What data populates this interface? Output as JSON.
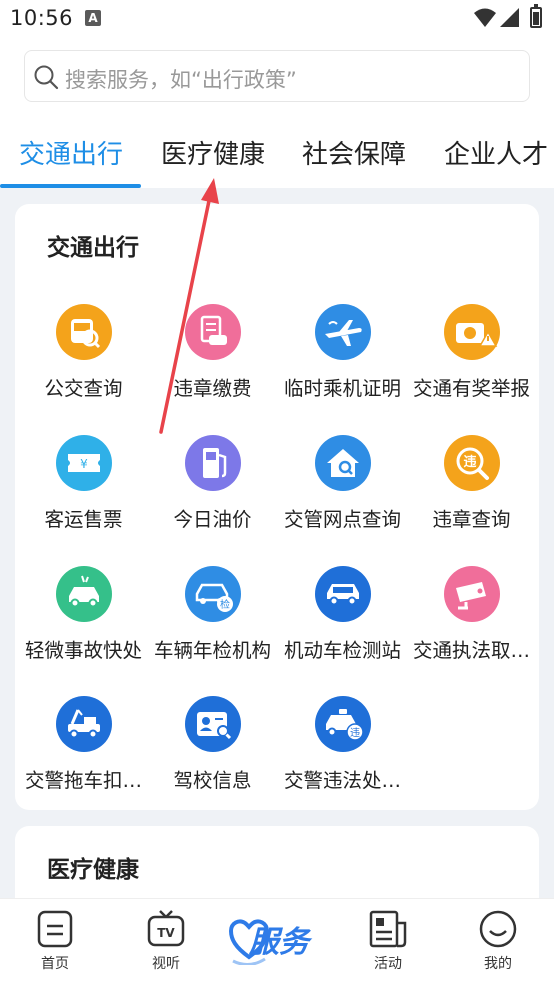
{
  "status_bar": {
    "time": "10:56",
    "notification_letter": "A"
  },
  "search": {
    "placeholder": "搜索服务，如“出行政策”"
  },
  "tabs": [
    {
      "label": "交通出行",
      "active": true
    },
    {
      "label": "医疗健康",
      "active": false
    },
    {
      "label": "社会保障",
      "active": false
    },
    {
      "label": "企业人才",
      "active": false
    }
  ],
  "sections": [
    {
      "title": "交通出行",
      "items": [
        {
          "label": "公交查询",
          "icon": "bus-search-icon",
          "color": "#f4a31b"
        },
        {
          "label": "违章缴费",
          "icon": "ticket-car-icon",
          "color": "#f06e9a"
        },
        {
          "label": "临时乘机证明",
          "icon": "airplane-icon",
          "color": "#2f8de4"
        },
        {
          "label": "交通有奖举报",
          "icon": "camera-warning-icon",
          "color": "#f4a31b"
        },
        {
          "label": "客运售票",
          "icon": "ticket-yen-icon",
          "color": "#2fb0e8"
        },
        {
          "label": "今日油价",
          "icon": "fuel-pump-icon",
          "color": "#7d78e8"
        },
        {
          "label": "交管网点查询",
          "icon": "house-search-icon",
          "color": "#2f8de4"
        },
        {
          "label": "违章查询",
          "icon": "violation-search-icon",
          "color": "#f4a31b"
        },
        {
          "label": "轻微事故快处",
          "icon": "car-accident-icon",
          "color": "#35c08a"
        },
        {
          "label": "车辆年检机构",
          "icon": "car-inspection-icon",
          "color": "#2f8de4"
        },
        {
          "label": "机动车检测站",
          "icon": "car-wrench-icon",
          "color": "#1f6fd8"
        },
        {
          "label": "交通执法取…",
          "icon": "surveillance-camera-icon",
          "color": "#f06e9a"
        },
        {
          "label": "交警拖车扣…",
          "icon": "tow-truck-icon",
          "color": "#1f6fd8"
        },
        {
          "label": "驾校信息",
          "icon": "id-card-icon",
          "color": "#1f6fd8"
        },
        {
          "label": "交警违法处…",
          "icon": "police-car-icon",
          "color": "#1f6fd8"
        }
      ]
    },
    {
      "title": "医疗健康"
    }
  ],
  "bottom_nav": [
    {
      "label": "首页",
      "icon": "home-icon"
    },
    {
      "label": "视听",
      "icon": "tv-icon"
    },
    {
      "label": "服务",
      "icon": "service-heart-icon"
    },
    {
      "label": "活动",
      "icon": "activity-document-icon"
    },
    {
      "label": "我的",
      "icon": "smiley-profile-icon"
    }
  ],
  "annotation": {
    "color": "#e8434a"
  }
}
